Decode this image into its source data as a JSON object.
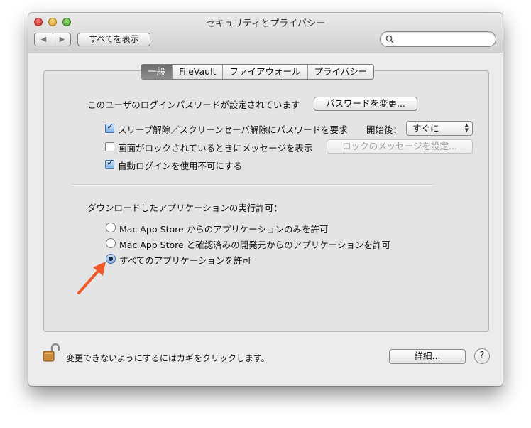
{
  "window": {
    "title": "セキュリティとプライバシー"
  },
  "toolbar": {
    "back_label": "◀",
    "forward_label": "▶",
    "show_all_label": "すべてを表示",
    "search_placeholder": ""
  },
  "tabs": [
    {
      "label": "一般",
      "selected": true
    },
    {
      "label": "FileVault",
      "selected": false
    },
    {
      "label": "ファイアウォール",
      "selected": false
    },
    {
      "label": "プライバシー",
      "selected": false
    }
  ],
  "general": {
    "password_text": "このユーザのログインパスワードが設定されています",
    "change_password_button": "パスワードを変更...",
    "require_password": {
      "label": "スリープ解除／スクリーンセーバ解除にパスワードを要求",
      "checked": true
    },
    "delay_label": "開始後：",
    "delay_value": "すぐに",
    "lock_message": {
      "label": "画面がロックされているときにメッセージを表示",
      "checked": false
    },
    "set_lock_message_button": "ロックのメッセージを設定...",
    "disable_auto_login": {
      "label": "自動ログインを使用不可にする",
      "checked": true
    },
    "download_heading": "ダウンロードしたアプリケーションの実行許可：",
    "download_options": [
      {
        "label": "Mac App Store からのアプリケーションのみを許可",
        "selected": false
      },
      {
        "label": "Mac App Store と確認済みの開発元からのアプリケーションを許可",
        "selected": false
      },
      {
        "label": "すべてのアプリケーションを許可",
        "selected": true
      }
    ]
  },
  "footer": {
    "lock_text": "変更できないようにするにはカギをクリックします。",
    "advanced_button": "詳細...",
    "help_label": "?"
  },
  "colors": {
    "annotation_arrow": "#f05a28",
    "selected_tab": "#7a7a7a",
    "check_blue": "#7fb0e6"
  }
}
